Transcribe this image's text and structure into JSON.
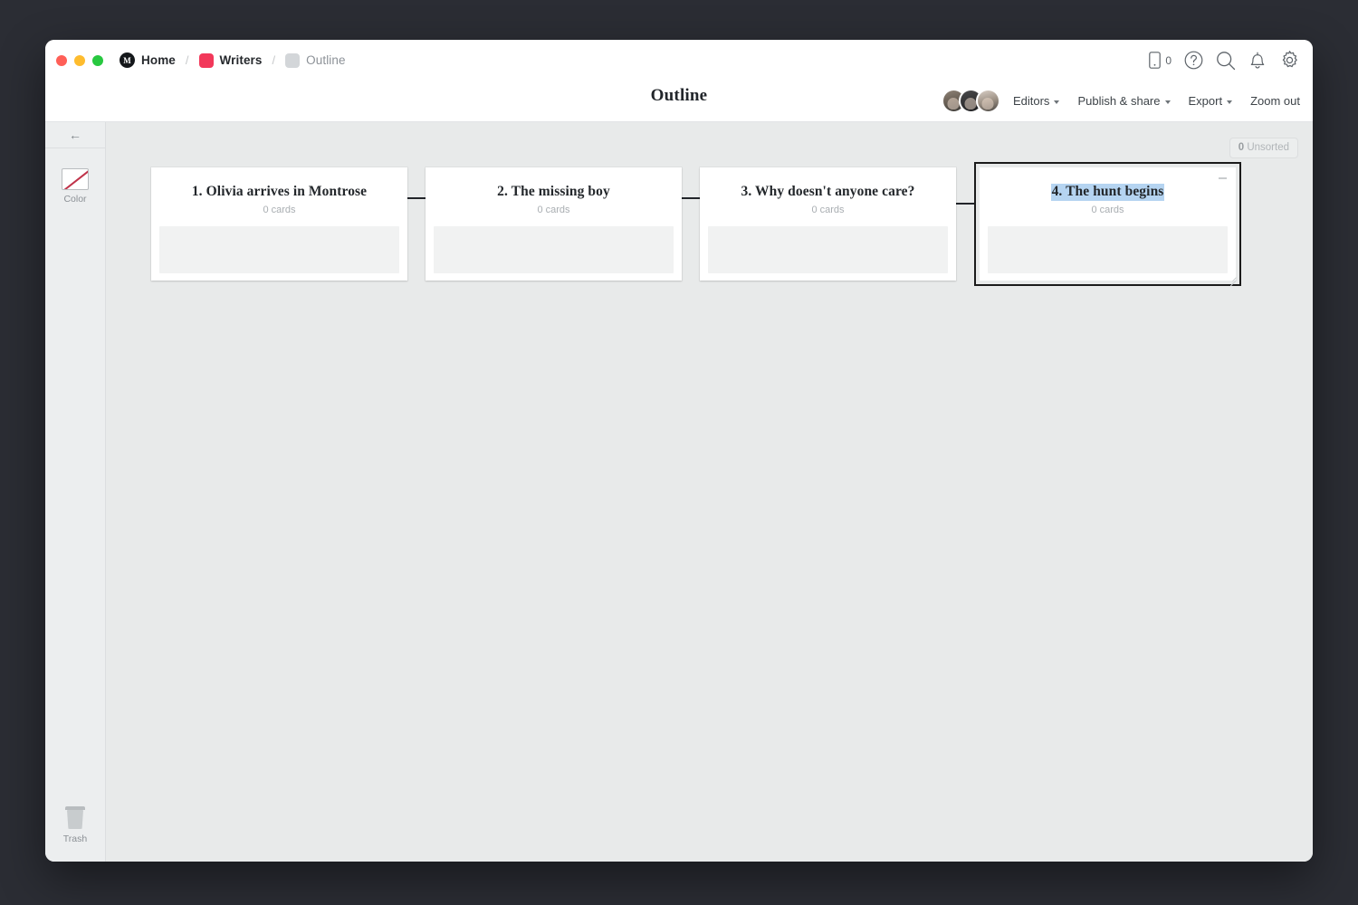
{
  "window": {
    "traffic_lights": [
      "close",
      "minimize",
      "maximize"
    ]
  },
  "breadcrumb": {
    "items": [
      {
        "label": "Home",
        "icon": "home-logo-icon",
        "color": "#15181b"
      },
      {
        "label": "Writers",
        "icon": "red-swatch-icon",
        "color": "#f2385a"
      },
      {
        "label": "Outline",
        "icon": "gray-swatch-icon",
        "color": "#d3d6d9"
      }
    ],
    "separator": "/"
  },
  "titlebar_icons": {
    "phone_label": "0",
    "items": [
      "mobile-icon",
      "help-icon",
      "search-icon",
      "bell-icon",
      "gear-icon"
    ]
  },
  "header": {
    "title": "Outline",
    "menus": [
      {
        "label": "Editors",
        "caret": true
      },
      {
        "label": "Publish & share",
        "caret": true
      },
      {
        "label": "Export",
        "caret": true
      },
      {
        "label": "Zoom out",
        "caret": false
      }
    ],
    "avatar_count": 3
  },
  "sidebar": {
    "back_arrow": "←",
    "tools": [
      {
        "id": "color",
        "label": "Color",
        "swatch": "none"
      },
      {
        "id": "trash",
        "label": "Trash"
      }
    ]
  },
  "canvas": {
    "unsorted": {
      "count": "0",
      "label": " Unsorted"
    },
    "background": "#e8eaea",
    "selection_highlight": "#b5d4f1",
    "cards": [
      {
        "title": "1. Olivia arrives in Montrose",
        "count": "0 cards",
        "selected": false
      },
      {
        "title": "2. The missing boy",
        "count": "0 cards",
        "selected": false
      },
      {
        "title": "3. Why doesn't anyone care?",
        "count": "0 cards",
        "selected": false
      },
      {
        "title": "4. The hunt begins",
        "count": "0 cards",
        "selected": true
      }
    ]
  }
}
